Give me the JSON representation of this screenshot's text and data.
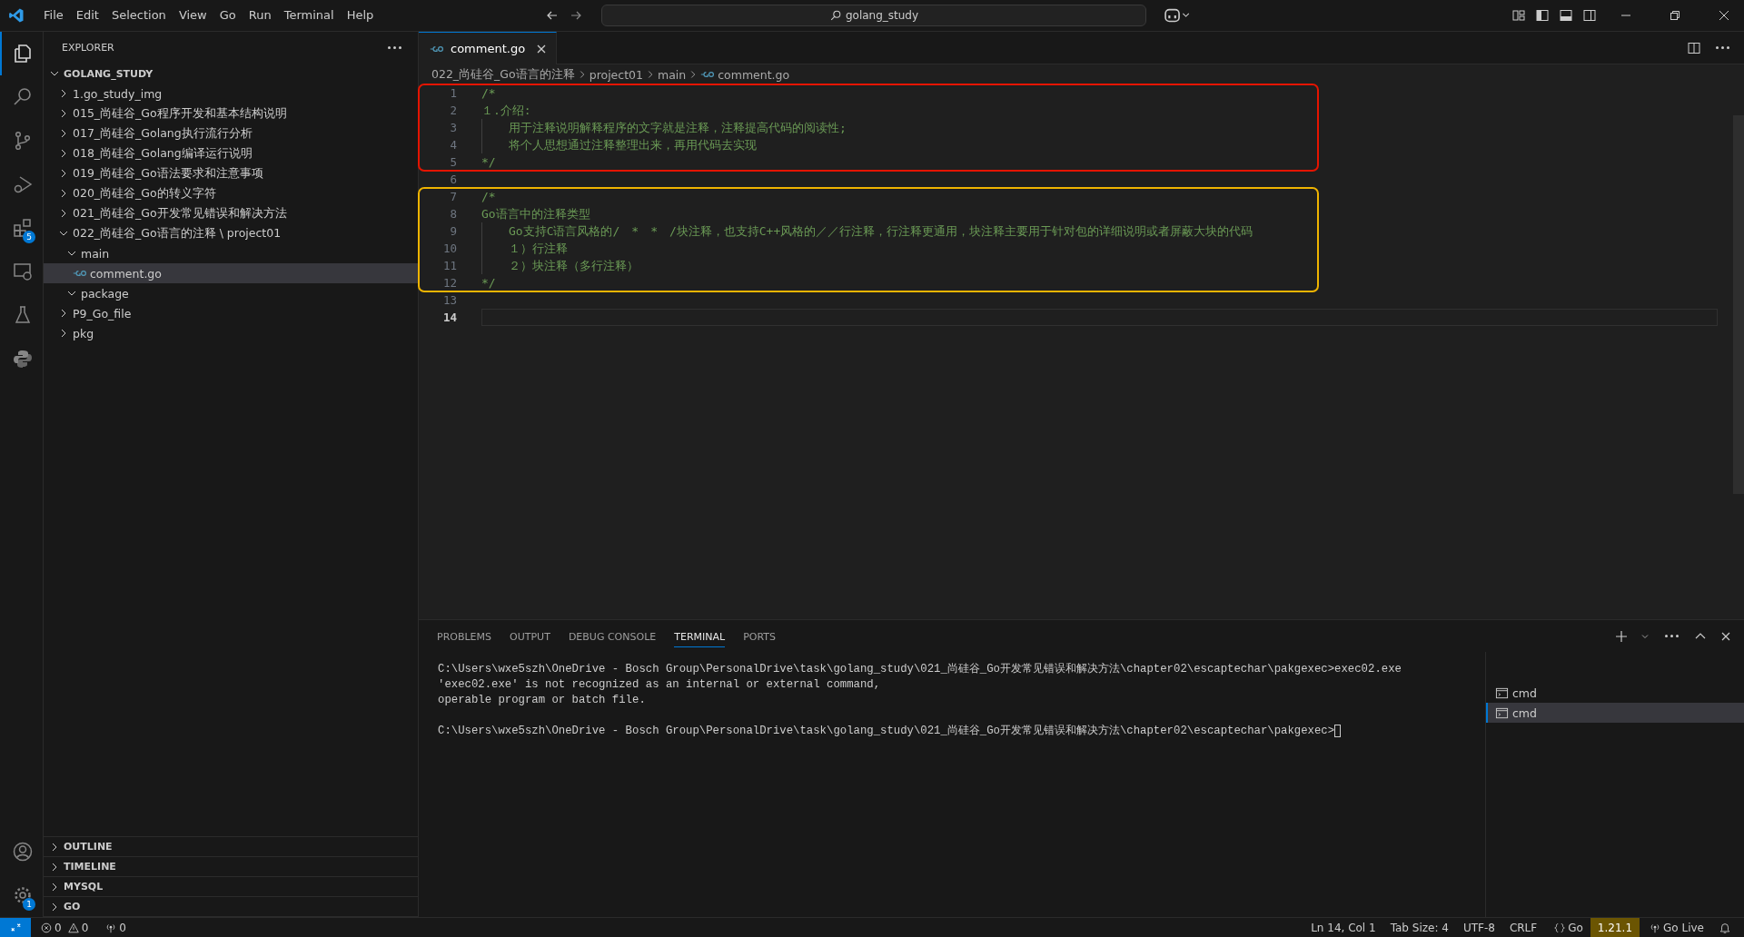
{
  "title_bar": {
    "menu": [
      "File",
      "Edit",
      "Selection",
      "View",
      "Go",
      "Run",
      "Terminal",
      "Help"
    ],
    "search": "golang_study"
  },
  "activity_bar": {
    "top": [
      {
        "kind": "explorer",
        "selected": true
      },
      {
        "kind": "search",
        "selected": false
      },
      {
        "kind": "source_control",
        "selected": false
      },
      {
        "kind": "run_debug",
        "selected": false
      },
      {
        "kind": "extensions",
        "selected": false,
        "badge": "5"
      },
      {
        "kind": "remote",
        "selected": false
      },
      {
        "kind": "testing",
        "selected": false
      },
      {
        "kind": "python",
        "selected": false
      }
    ],
    "bottom": [
      {
        "kind": "account"
      },
      {
        "kind": "settings",
        "badge": "1"
      }
    ]
  },
  "sidebar": {
    "title": "EXPLORER",
    "workspace": {
      "label": "GOLANG_STUDY",
      "expanded": true,
      "children": [
        {
          "kind": "folder",
          "label": "1.go_study_img",
          "expanded": false,
          "selected": false
        },
        {
          "kind": "folder",
          "label": "015_尚硅谷_Go程序开发和基本结构说明",
          "expanded": false,
          "selected": false
        },
        {
          "kind": "folder",
          "label": "017_尚硅谷_Golang执行流行分析",
          "expanded": false,
          "selected": false
        },
        {
          "kind": "folder",
          "label": "018_尚硅谷_Golang编译运行说明",
          "expanded": false,
          "selected": false
        },
        {
          "kind": "folder",
          "label": "019_尚硅谷_Go语法要求和注意事项",
          "expanded": false,
          "selected": false
        },
        {
          "kind": "folder",
          "label": "020_尚硅谷_Go的转义字符",
          "expanded": false,
          "selected": false
        },
        {
          "kind": "folder",
          "label": "021_尚硅谷_Go开发常见错误和解决方法",
          "expanded": false,
          "selected": false
        },
        {
          "kind": "folder",
          "label": "022_尚硅谷_Go语言的注释 \\ project01",
          "expanded": true,
          "selected": false,
          "children": [
            {
              "kind": "folder",
              "label": "main",
              "expanded": true,
              "selected": false,
              "children": [
                {
                  "kind": "file",
                  "label": "comment.go",
                  "selected": true
                }
              ]
            },
            {
              "kind": "folder",
              "label": "package",
              "expanded": true,
              "selected": false
            }
          ]
        },
        {
          "kind": "folder",
          "label": "P9_Go_file",
          "expanded": false,
          "selected": false
        },
        {
          "kind": "folder",
          "label": "pkg",
          "expanded": false,
          "selected": false
        }
      ]
    },
    "sections": [
      {
        "label": "OUTLINE",
        "expanded": false
      },
      {
        "label": "TIMELINE",
        "expanded": false
      },
      {
        "label": "MYSQL",
        "expanded": false
      },
      {
        "label": "GO",
        "expanded": false
      }
    ]
  },
  "editor": {
    "tabs": [
      {
        "label": "comment.go",
        "selected": true
      }
    ],
    "breadcrumbs": [
      "022_尚硅谷_Go语言的注释",
      "project01",
      "main",
      "comment.go"
    ],
    "blocks": [
      {
        "color": "#e51400",
        "lines": [
          {
            "number": "1",
            "text": "/*",
            "current": false
          },
          {
            "number": "2",
            "text": "１.介绍:",
            "current": false,
            "children": [
              {
                "number": "3",
                "text": "用于注释说明解释程序的文字就是注释，注释提高代码的阅读性;",
                "current": false
              },
              {
                "number": "4",
                "text": "将个人思想通过注释整理出来，再用代码去实现",
                "current": false
              }
            ]
          },
          {
            "number": "5",
            "text": "*/",
            "current": false
          }
        ]
      },
      {
        "lines": [
          {
            "number": "6",
            "current": false
          }
        ]
      },
      {
        "color": "#f0b400",
        "lines": [
          {
            "number": "7",
            "text": "/*",
            "current": false
          },
          {
            "number": "8",
            "text": "Go语言中的注释类型",
            "current": false,
            "children": [
              {
                "number": "9",
                "text": "Go支持C语言风格的/　*　*　/块注释，也支持C++风格的／／行注释，行注释更通用，块注释主要用于针对包的详细说明或者屏蔽大块的代码",
                "current": false
              },
              {
                "number": "10",
                "text": "１）行注释",
                "current": false
              },
              {
                "number": "11",
                "text": "２）块注释（多行注释）",
                "current": false
              }
            ]
          },
          {
            "number": "12",
            "text": "*/",
            "current": false
          }
        ]
      },
      {
        "lines": [
          {
            "number": "13",
            "current": false
          },
          {
            "number": "14",
            "current": true
          }
        ]
      }
    ]
  },
  "panel": {
    "tabs": [
      {
        "label": "PROBLEMS",
        "selected": false
      },
      {
        "label": "OUTPUT",
        "selected": false
      },
      {
        "label": "DEBUG CONSOLE",
        "selected": false
      },
      {
        "label": "TERMINAL",
        "selected": true
      },
      {
        "label": "PORTS",
        "selected": false
      }
    ],
    "terminal_groups": [
      [
        "C:\\Users\\wxe5szh\\OneDrive - Bosch Group\\PersonalDrive\\task\\golang_study\\021_尚硅谷_Go开发常见错误和解决方法\\chapter02\\escaptechar\\pakgexec>exec02.exe",
        "'exec02.exe' is not recognized as an internal or external command,",
        "operable program or batch file."
      ],
      [
        "C:\\Users\\wxe5szh\\OneDrive - Bosch Group\\PersonalDrive\\task\\golang_study\\021_尚硅谷_Go开发常见错误和解决方法\\chapter02\\escaptechar\\pakgexec>"
      ]
    ],
    "instances": [
      {
        "label": "cmd",
        "selected": false
      },
      {
        "label": "cmd",
        "selected": true
      }
    ]
  },
  "status_bar": {
    "left": [
      {
        "kind": "errors",
        "text": "0"
      },
      {
        "kind": "warnings",
        "text": "0"
      },
      {
        "kind": "ports",
        "text": "0"
      }
    ],
    "right": [
      {
        "kind": "text",
        "text": "Ln 14, Col 1"
      },
      {
        "kind": "text",
        "text": "Tab Size: 4"
      },
      {
        "kind": "text",
        "text": "UTF-8"
      },
      {
        "kind": "text",
        "text": "CRLF"
      },
      {
        "kind": "language",
        "text": "Go"
      },
      {
        "kind": "version",
        "text": "1.21.1"
      },
      {
        "kind": "live",
        "text": "Go Live"
      },
      {
        "kind": "bell"
      }
    ]
  }
}
